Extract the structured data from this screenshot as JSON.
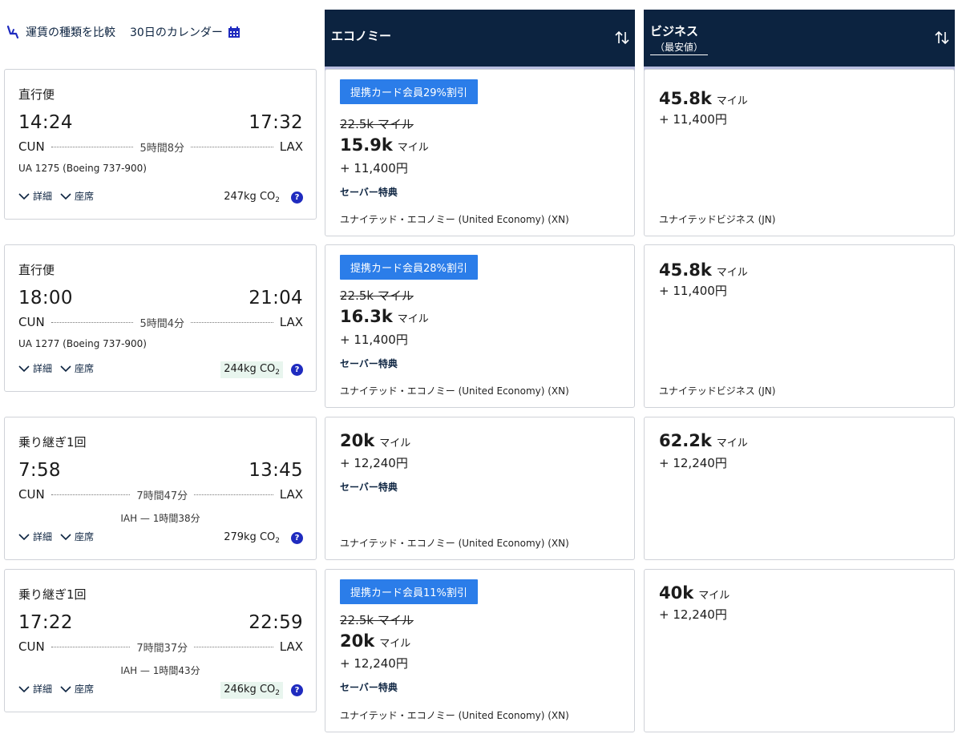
{
  "topbar": {
    "compare_label": "運賃の種類を比較",
    "calendar_label": "30日のカレンダー"
  },
  "columns": {
    "economy": {
      "title": "エコノミー"
    },
    "business": {
      "title": "ビジネス",
      "subtitle": "（最安値）"
    }
  },
  "colors": {
    "header_bg": "#0c2340",
    "header_bar": "#b8bde0",
    "badge": "#2b7de9",
    "help_icon": "#1f2bbf"
  },
  "labels": {
    "details": "詳細",
    "seats": "座席",
    "co2_unit": "CO",
    "co2_sub": "2",
    "help": "?",
    "miles_unit": "マイル",
    "saver": "セーバー特典"
  },
  "flights": [
    {
      "type": "直行便",
      "dep_time": "14:24",
      "arr_time": "17:32",
      "origin": "CUN",
      "dest": "LAX",
      "duration": "5時間8分",
      "info": "UA 1275 (Boeing 737-900)",
      "connection": "",
      "co2": "247kg",
      "co2_highlight": false,
      "economy": {
        "badge": "提携カード会員29%割引",
        "original": "22.5k マイル",
        "miles": "15.9k",
        "tax": "+ 11,400円",
        "saver": true,
        "cabin": "ユナイテッド・エコノミー (United Economy) (XN)"
      },
      "business": {
        "miles": "45.8k",
        "tax": "+ 11,400円",
        "cabin": "ユナイテッドビジネス (JN)"
      }
    },
    {
      "type": "直行便",
      "dep_time": "18:00",
      "arr_time": "21:04",
      "origin": "CUN",
      "dest": "LAX",
      "duration": "5時間4分",
      "info": "UA 1277 (Boeing 737-900)",
      "connection": "",
      "co2": "244kg",
      "co2_highlight": true,
      "economy": {
        "badge": "提携カード会員28%割引",
        "original": "22.5k マイル",
        "miles": "16.3k",
        "tax": "+ 11,400円",
        "saver": true,
        "cabin": "ユナイテッド・エコノミー (United Economy) (XN)"
      },
      "business": {
        "miles": "45.8k",
        "tax": "+ 11,400円",
        "cabin": "ユナイテッドビジネス (JN)"
      }
    },
    {
      "type": "乗り継ぎ1回",
      "dep_time": "7:58",
      "arr_time": "13:45",
      "origin": "CUN",
      "dest": "LAX",
      "duration": "7時間47分",
      "info": "",
      "connection": "IAH — 1時間38分",
      "co2": "279kg",
      "co2_highlight": false,
      "economy": {
        "badge": "",
        "original": "",
        "miles": "20k",
        "tax": "+ 12,240円",
        "saver": true,
        "cabin": "ユナイテッド・エコノミー (United Economy) (XN)"
      },
      "business": {
        "miles": "62.2k",
        "tax": "+ 12,240円",
        "cabin": ""
      }
    },
    {
      "type": "乗り継ぎ1回",
      "dep_time": "17:22",
      "arr_time": "22:59",
      "origin": "CUN",
      "dest": "LAX",
      "duration": "7時間37分",
      "info": "",
      "connection": "IAH — 1時間43分",
      "co2": "246kg",
      "co2_highlight": true,
      "economy": {
        "badge": "提携カード会員11%割引",
        "original": "22.5k マイル",
        "miles": "20k",
        "tax": "+ 12,240円",
        "saver": true,
        "cabin": "ユナイテッド・エコノミー (United Economy) (XN)"
      },
      "business": {
        "miles": "40k",
        "tax": "+ 12,240円",
        "cabin": ""
      }
    }
  ]
}
